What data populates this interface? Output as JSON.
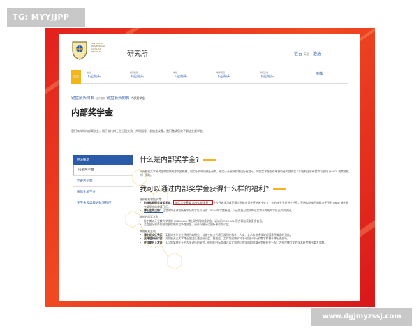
{
  "watermarks": {
    "top": "TG: MYYJJPP",
    "bottom": "www.dgjmyzssj.com"
  },
  "header": {
    "site_title": "研究所",
    "logo_lines": [
      "PONTIFICIA",
      "UNIVERSIDAD",
      "CATÓLICA",
      "DE CHILE"
    ],
    "right_link": "谊吉",
    "right_small": "英语",
    "right_link2": "遴选"
  },
  "nav": {
    "home": "主页",
    "items": [
      {
        "small": "信息",
        "label": "下拉箭头"
      },
      {
        "small": "经济援助",
        "label": "下拉箭头"
      },
      {
        "small": "学位",
        "label": "下拉箭头"
      },
      {
        "small": "学术项目",
        "label": "下拉箭头"
      },
      {
        "small": "我们是谁",
        "label": "下拉箭头"
      },
      {
        "small": "",
        "label": "接触"
      }
    ]
  },
  "breadcrumb": {
    "first": "键盘箭头向右",
    "small": "经济援助",
    "second": "键盘箭头向右",
    "current": "内部奖学金"
  },
  "page_title": "内部奖学金",
  "intro": "我们每年将内部奖学金，用于支持博士生出国交流、共同指导、参加会议等。我们邀请您来了解这些奖学金。",
  "sidebar": {
    "head": "经济援助",
    "items": [
      "内部奖学金",
      "外部奖学金",
      "国际化奖学金",
      "奖学金及高级进阶证程序"
    ]
  },
  "main": {
    "h2_1": "什么是内部奖学金?",
    "p1": "科英和拉大学研究生院提供内部奖励机制，用用于资助成绩士研究。也用于开展补充性国际化活动。内部奖学金面在单独仍在内部资金（如智利国家研究和发展局 (ANID) 或其他机构）资助。",
    "h2_2": "我可以通过内部奖学金获得什么样的福利?",
    "benefits_title": "德护福利和免学费：",
    "b1_bold": "助教和助研学者奖学金：",
    "b1_highlight": "博奖学金覆盖 100% 的学费，",
    "b1_rest": "并为开始学习或已通过资格考试并开始博士论文工作的博士生提供生活费。开始和结束日期取决于智利 ANID 博士研究奖学金的申请日历。",
    "b2_bold": "博士生的注销：",
    "b2_rest": "已完成博士课程所有学分的学生可获得 100% 的学费补贴，以还包括已完成的论文和未完成的学位论文的学分。",
    "other_benefits": "其他内部奖学金：",
    "b3": "拉丁美洲天主教大学组织 (ODUCAL) 博士研究网络奖学金。请访问 ODUCAL 官方网站获取更多信息。",
    "b4": "主管国际事务的副校长提供的竞争性资金。请访问国际化国际事务办公室。",
    "other_section": "其他福利支助",
    "b5_bold": "博士论文优秀奖：",
    "b5": "奖励博士毕业生所进行的研究。其博士论文代表了我们在科学、人文、艺术和技术领域对国家所做出的贡献。",
    "b6_bold": "支持组织研讨会：",
    "b6": "资助由天主大学博士生团队通过研讨会、座谈会、工作坊或跨学科活动组织同行及教学和基于博士进展行。",
    "b7_bold": "在顶期刊上发表：",
    "b7": "认可和奖励在天主大学进行的研究。他们的目标是通过公文和他们的学科和领域研究能在在一起，为在传播文化的学术研究做出重大贡献。"
  },
  "colors": {
    "frame_red": "#e1201d",
    "accent_yellow": "#f2b51e",
    "link_blue": "#2a5aa8",
    "highlight_red": "#c2191d"
  }
}
